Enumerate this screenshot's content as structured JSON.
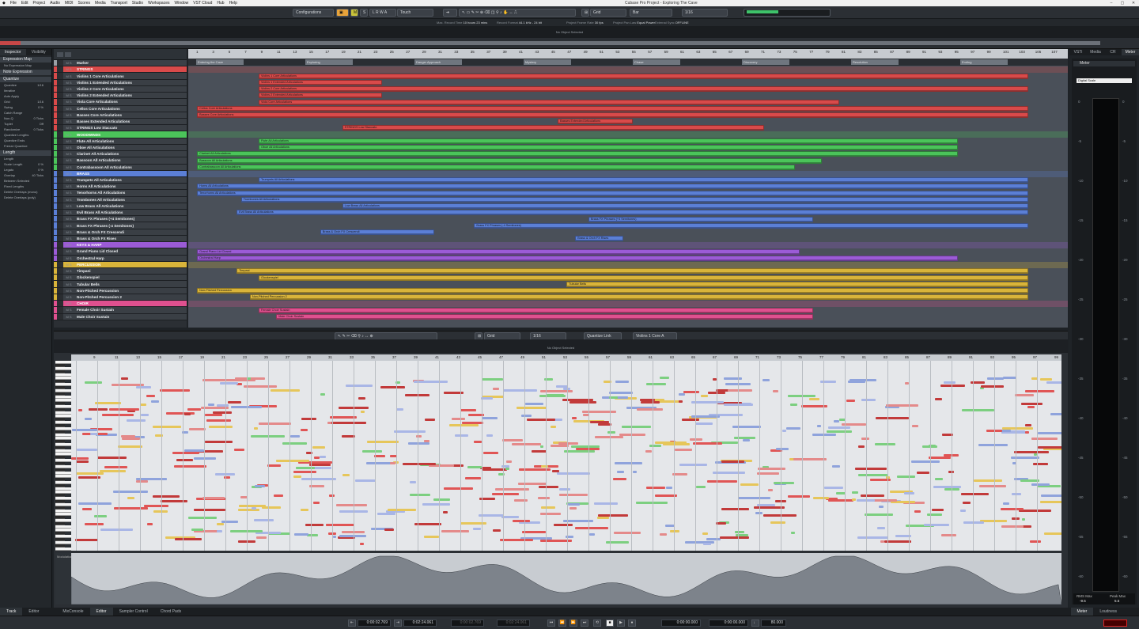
{
  "menu": [
    "File",
    "Edit",
    "Project",
    "Audio",
    "MIDI",
    "Scores",
    "Media",
    "Transport",
    "Studio",
    "Workspaces",
    "Window",
    "VST Cloud",
    "Hub",
    "Help"
  ],
  "window_title": "Cubase Pro Project - Exploring The Cave",
  "toolbar": {
    "configurations": "Configurations",
    "auto_mode": "Touch",
    "grid": "Grid",
    "snap": "Bar",
    "quantize": "1/16"
  },
  "infoline": [
    {
      "label": "Max. Record Time",
      "value": "10 hours 23 mins"
    },
    {
      "label": "Record Format",
      "value": "44.1 kHz - 24 bit"
    },
    {
      "label": "Project Frame Rate",
      "value": "30 fps"
    },
    {
      "label": "Project Pan Law",
      "value": "Equal Power"
    },
    {
      "label": "External Sync",
      "value": "OFFLINE"
    }
  ],
  "status_text": "No Object Selected",
  "inspector": {
    "tabs": [
      "Inspector",
      "Visibility"
    ],
    "sections": [
      {
        "title": "Expression Map",
        "rows": [
          {
            "l": "No Expression Map",
            "v": ""
          }
        ]
      },
      {
        "title": "Note Expression",
        "rows": []
      },
      {
        "title": "Quantize",
        "rows": [
          {
            "l": "Quantize",
            "v": "1/16"
          },
          {
            "l": "Iterative",
            "v": ""
          },
          {
            "l": "Auto Apply",
            "v": ""
          },
          {
            "l": "Grid",
            "v": "1/16"
          },
          {
            "l": "Swing",
            "v": "0 %"
          },
          {
            "l": "Catch Range",
            "v": ""
          },
          {
            "l": "Non-Q",
            "v": "0 Ticks"
          },
          {
            "l": "Tuplet",
            "v": "Off"
          },
          {
            "l": "Randomize",
            "v": "0 Ticks"
          },
          {
            "l": "Quantize Lengths",
            "v": ""
          },
          {
            "l": "Quantize Ends",
            "v": ""
          },
          {
            "l": "Freeze Quantize",
            "v": ""
          }
        ]
      },
      {
        "title": "Length",
        "rows": [
          {
            "l": "Length",
            "v": ""
          },
          {
            "l": "Scale Length",
            "v": "0 %"
          },
          {
            "l": "Legato",
            "v": "0 %"
          },
          {
            "l": "Overlap",
            "v": "40 Ticks"
          },
          {
            "l": "Between Selected",
            "v": ""
          },
          {
            "l": "Fixed Lengths",
            "v": ""
          },
          {
            "l": "Delete Overlaps (mono)",
            "v": ""
          },
          {
            "l": "Delete Overlaps (poly)",
            "v": ""
          }
        ]
      }
    ]
  },
  "tracks": [
    {
      "name": "Marker",
      "color": "#9aa0a6",
      "folder": false,
      "num": ""
    },
    {
      "name": "STRINGS",
      "color": "#d94a4a",
      "folder": true
    },
    {
      "name": "Violins 1 Core Articulations",
      "color": "#d94a4a"
    },
    {
      "name": "Violins 1 Extended Articulations",
      "color": "#d94a4a"
    },
    {
      "name": "Violins 2 Core Articulations",
      "color": "#d94a4a"
    },
    {
      "name": "Violins 2 Extended Articulations",
      "color": "#d94a4a"
    },
    {
      "name": "Viola Core Articulations",
      "color": "#d94a4a"
    },
    {
      "name": "Cellos Core Articulations",
      "color": "#d94a4a"
    },
    {
      "name": "Basses Core Articulations",
      "color": "#d94a4a"
    },
    {
      "name": "Basses Extended Articulations",
      "color": "#d94a4a"
    },
    {
      "name": "STRINGS Low Staccato",
      "color": "#d94a4a"
    },
    {
      "name": "WOODWINDS",
      "color": "#4bc45a",
      "folder": true
    },
    {
      "name": "Flute All Articulations",
      "color": "#4bc45a"
    },
    {
      "name": "Oboe All Articulations",
      "color": "#4bc45a"
    },
    {
      "name": "Clarinet All Articulations",
      "color": "#4bc45a"
    },
    {
      "name": "Bassoon All Articulations",
      "color": "#4bc45a"
    },
    {
      "name": "Contrabassoon All Articulations",
      "color": "#4bc45a"
    },
    {
      "name": "BRASS",
      "color": "#5b7fd6",
      "folder": true
    },
    {
      "name": "Trumpets All Articulations",
      "color": "#5b7fd6"
    },
    {
      "name": "Horns All Articulations",
      "color": "#5b7fd6"
    },
    {
      "name": "Tenorhorns All Articulations",
      "color": "#5b7fd6"
    },
    {
      "name": "Trombones All Articulations",
      "color": "#5b7fd6"
    },
    {
      "name": "Low Brass All Articulations",
      "color": "#5b7fd6"
    },
    {
      "name": "Evil Brass All Articulations",
      "color": "#5b7fd6"
    },
    {
      "name": "Brass FX Phrases (+4 Semitones)",
      "color": "#5b7fd6"
    },
    {
      "name": "Brass FX Phrases (-4 Semitones)",
      "color": "#5b7fd6"
    },
    {
      "name": "Brass & Orch FX Crescendi",
      "color": "#5b7fd6"
    },
    {
      "name": "Brass & Orch FX Rises",
      "color": "#5b7fd6"
    },
    {
      "name": "KEYS & HARP",
      "color": "#9b5bd6",
      "folder": true
    },
    {
      "name": "Grand Piano Lid Closed",
      "color": "#9b5bd6"
    },
    {
      "name": "Orchestral Harp",
      "color": "#9b5bd6"
    },
    {
      "name": "PERCUSSION",
      "color": "#d9b43a",
      "folder": true
    },
    {
      "name": "Timpani",
      "color": "#d9b43a"
    },
    {
      "name": "Glockenspiel",
      "color": "#d9b43a"
    },
    {
      "name": "Tubular Bells",
      "color": "#d9b43a"
    },
    {
      "name": "Non-Pitched Percussion",
      "color": "#d9b43a"
    },
    {
      "name": "Non-Pitched Percussion 2",
      "color": "#d9b43a"
    },
    {
      "name": "CHOIR",
      "color": "#e0508f",
      "folder": true
    },
    {
      "name": "Female Choir Sustain",
      "color": "#e0508f"
    },
    {
      "name": "Male Choir Sustain",
      "color": "#e0508f"
    }
  ],
  "ruler_bars": [
    "1",
    "3",
    "5",
    "7",
    "9",
    "11",
    "13",
    "15",
    "17",
    "19",
    "21",
    "23",
    "25",
    "27",
    "29",
    "31",
    "33",
    "35",
    "37",
    "39",
    "41",
    "43",
    "45",
    "47",
    "49",
    "51",
    "53",
    "55",
    "57",
    "59",
    "61",
    "63",
    "65",
    "67",
    "69",
    "71",
    "73",
    "75",
    "77",
    "79",
    "81",
    "83",
    "85",
    "87",
    "89",
    "91",
    "93",
    "95",
    "97",
    "99",
    "101",
    "103",
    "105",
    "107"
  ],
  "markers": [
    "Entering the Cave",
    "Exploring",
    "Danger Approach",
    "Mystery",
    "Chase",
    "Discovery",
    "Resolution",
    "Ending"
  ],
  "events": [
    {
      "t": 2,
      "s": 0.08,
      "e": 0.955,
      "label": "Violins 1 Core Articulations"
    },
    {
      "t": 3,
      "s": 0.08,
      "e": 0.22,
      "label": "Violins 1 Extended Articulations"
    },
    {
      "t": 4,
      "s": 0.08,
      "e": 0.955,
      "label": "Violins 2 Core Articulations"
    },
    {
      "t": 5,
      "s": 0.08,
      "e": 0.22,
      "label": "Violins 2 Extended Articulations"
    },
    {
      "t": 6,
      "s": 0.08,
      "e": 0.74,
      "label": "Viola Core Articulations"
    },
    {
      "t": 7,
      "s": 0.01,
      "e": 0.955,
      "label": "Cellos Core Articulations"
    },
    {
      "t": 8,
      "s": 0.01,
      "e": 0.955,
      "label": "Basses Core Articulations"
    },
    {
      "t": 9,
      "s": 0.42,
      "e": 0.505,
      "label": "Basses Extended Articulations"
    },
    {
      "t": 10,
      "s": 0.175,
      "e": 0.655,
      "label": "STRINGS Low Staccato"
    },
    {
      "t": 12,
      "s": 0.08,
      "e": 0.875,
      "label": "Flute All Articulations"
    },
    {
      "t": 13,
      "s": 0.08,
      "e": 0.875,
      "label": "Oboe All Articulations"
    },
    {
      "t": 14,
      "s": 0.01,
      "e": 0.875,
      "label": "Clarinet All Articulations"
    },
    {
      "t": 15,
      "s": 0.01,
      "e": 0.72,
      "label": "Bassoon All Articulations"
    },
    {
      "t": 16,
      "s": 0.01,
      "e": 0.69,
      "label": "Contrabassoon All Articulations"
    },
    {
      "t": 18,
      "s": 0.08,
      "e": 0.955,
      "label": "Trumpets All Articulations"
    },
    {
      "t": 19,
      "s": 0.01,
      "e": 0.955,
      "label": "Horns All Articulations"
    },
    {
      "t": 20,
      "s": 0.01,
      "e": 0.955,
      "label": "Tenorhorns All Articulations"
    },
    {
      "t": 21,
      "s": 0.06,
      "e": 0.955,
      "label": "Trombones All Articulations"
    },
    {
      "t": 22,
      "s": 0.175,
      "e": 0.955,
      "label": "Low Brass All Articulations"
    },
    {
      "t": 23,
      "s": 0.055,
      "e": 0.955,
      "label": "Evil Brass All Articulations"
    },
    {
      "t": 24,
      "s": 0.455,
      "e": 0.71,
      "label": "Brass FX Phrases (+4 Semitones)"
    },
    {
      "t": 25,
      "s": 0.325,
      "e": 0.955,
      "label": "Brass FX Phrases (-4 Semitones)"
    },
    {
      "t": 26,
      "s": 0.15,
      "e": 0.28,
      "label": "Brass & Orch FX Crescendi"
    },
    {
      "t": 27,
      "s": 0.44,
      "e": 0.495,
      "label": "Brass & Orch FX Rises"
    },
    {
      "t": 29,
      "s": 0.01,
      "e": 0.695,
      "label": "Grand Piano Lid Closed"
    },
    {
      "t": 30,
      "s": 0.01,
      "e": 0.875,
      "label": "Orchestral Harp"
    },
    {
      "t": 32,
      "s": 0.055,
      "e": 0.955,
      "label": "Timpani"
    },
    {
      "t": 33,
      "s": 0.08,
      "e": 0.955,
      "label": "Glockenspiel"
    },
    {
      "t": 34,
      "s": 0.43,
      "e": 0.955,
      "label": "Tubular Bells"
    },
    {
      "t": 35,
      "s": 0.01,
      "e": 0.955,
      "label": "Non-Pitched Percussion"
    },
    {
      "t": 36,
      "s": 0.07,
      "e": 0.955,
      "label": "Non-Pitched Percussion 2"
    },
    {
      "t": 38,
      "s": 0.08,
      "e": 0.71,
      "label": "Female Choir Sustain"
    },
    {
      "t": 39,
      "s": 0.1,
      "e": 0.71,
      "label": "Male Choir Sustain"
    }
  ],
  "right_tabs": [
    "VSTi",
    "Media",
    "CR",
    "Meter"
  ],
  "meter": {
    "title": "Meter",
    "scale_mode": "Digital Scale",
    "scale": [
      "0",
      "-5",
      "-10",
      "-15",
      "-20",
      "-25",
      "-30",
      "-35",
      "-40",
      "-45",
      "-50",
      "-55",
      "-60"
    ],
    "rms_label": "RMS Max",
    "rms_value": "-9.5",
    "peak_label": "Peak Max",
    "peak_value": "5.5"
  },
  "editor": {
    "grid": "Grid",
    "quantize": "1/16",
    "quantize_link": "Quantize Link",
    "track": "Violins 1 Core A",
    "status": "No Object Selected",
    "bars": [
      "9",
      "11",
      "13",
      "15",
      "17",
      "19",
      "21",
      "23",
      "25",
      "27",
      "29",
      "31",
      "33",
      "35",
      "37",
      "39",
      "41",
      "43",
      "45",
      "47",
      "49",
      "51",
      "53",
      "55",
      "57",
      "59",
      "61",
      "63",
      "65",
      "67",
      "69",
      "71",
      "73",
      "75",
      "77",
      "79",
      "81",
      "83",
      "85",
      "87",
      "89",
      "91",
      "93",
      "95",
      "97",
      "99"
    ],
    "controller_label": "Modulation"
  },
  "bottom_tabs": {
    "left": [
      "Track",
      "Editor"
    ],
    "mid": [
      "MixConsole",
      "Editor",
      "Sampler Control",
      "Chord Pads"
    ],
    "right": [
      "Meter",
      "Loudness"
    ]
  },
  "transport": {
    "pos_primary": "0:00:02.769",
    "pos_secondary": "0:02:24.061",
    "left_locator": "0:00:02.769",
    "right_locator": "0:02:24.061",
    "cycle_time": "0:00:00.000",
    "time2": "0:00:00.000",
    "tempo": "80.000"
  },
  "colors": {
    "strings": "#d94a4a",
    "woodwinds": "#4bc45a",
    "brass": "#5b7fd6",
    "keys": "#9b5bd6",
    "percussion": "#d9b43a",
    "choir": "#e0508f"
  }
}
